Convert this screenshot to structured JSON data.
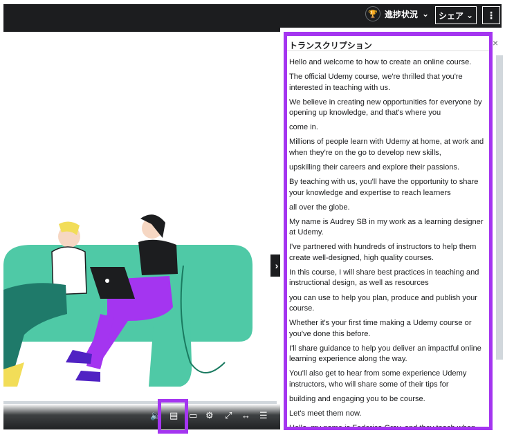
{
  "header": {
    "progress_label": "進捗状況",
    "share_label": "シェア",
    "more_icon": "⋮",
    "trophy_icon": "trophy-icon"
  },
  "player": {
    "next_icon": "chevron-right-icon"
  },
  "transcript": {
    "title": "トランスクリプション",
    "cues": [
      "Hello and welcome to how to create an online course.",
      "The official Udemy course, we're thrilled that you're interested in teaching with us.",
      "We believe in creating new opportunities for everyone by opening up knowledge, and that's where you",
      "come in.",
      "Millions of people learn with Udemy at home, at work and when they're on the go to develop new skills,",
      "upskilling their careers and explore their passions.",
      "By teaching with us, you'll have the opportunity to share your knowledge and expertise to reach learners",
      "all over the globe.",
      "My name is Audrey SB in my work as a learning designer at Udemy.",
      "I've partnered with hundreds of instructors to help them create well-designed, high quality courses.",
      "In this course, I will share best practices in teaching and instructional design, as well as resources",
      "you can use to help you plan, produce and publish your course.",
      "Whether it's your first time making a Udemy course or you've done this before.",
      "I'll share guidance to help you deliver an impactful online learning experience along the way.",
      "You'll also get to hear from some experience Udemy instructors, who will share some of their tips for",
      "building and engaging you to be course.",
      "Let's meet them now.",
      "Hello, my name is Federico Gray, and they teach when"
    ]
  },
  "colors": {
    "accent": "#a435f0",
    "topbar": "#1c1d1f",
    "sofa": "#4fc9a6"
  }
}
